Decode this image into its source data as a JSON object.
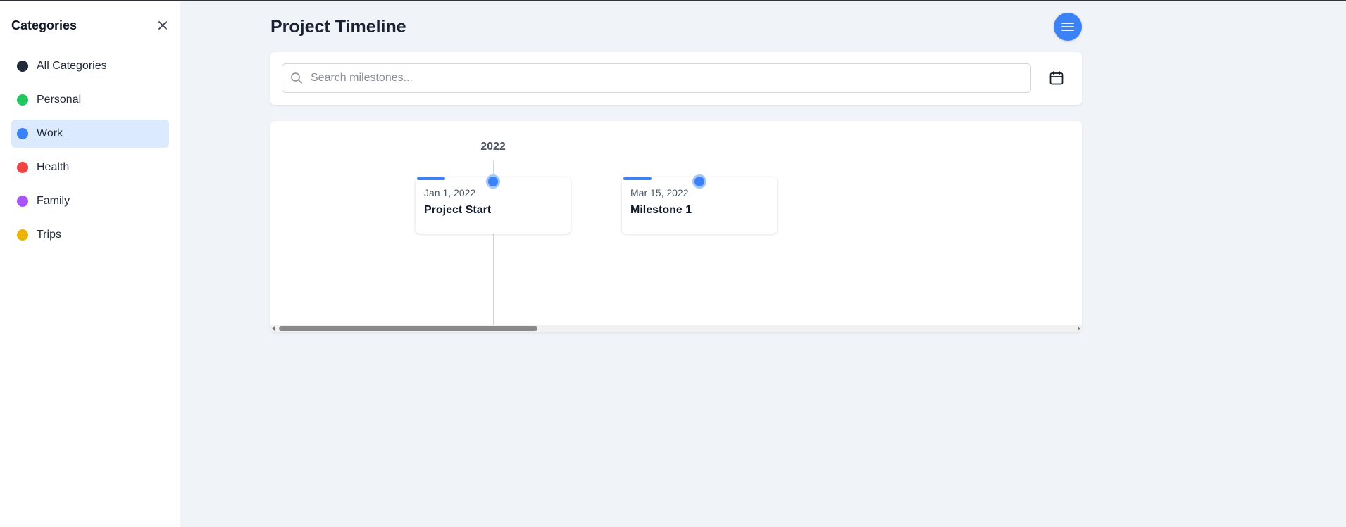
{
  "sidebar": {
    "title": "Categories",
    "items": [
      {
        "label": "All Categories",
        "color": "#1f2937",
        "active": false
      },
      {
        "label": "Personal",
        "color": "#22c55e",
        "active": false
      },
      {
        "label": "Work",
        "color": "#3b82f6",
        "active": true
      },
      {
        "label": "Health",
        "color": "#ef4444",
        "active": false
      },
      {
        "label": "Family",
        "color": "#a855f7",
        "active": false
      },
      {
        "label": "Trips",
        "color": "#eab308",
        "active": false
      }
    ]
  },
  "header": {
    "title": "Project Timeline",
    "menu_icon": "hamburger-menu-icon"
  },
  "search": {
    "placeholder": "Search milestones...",
    "value": "",
    "calendar_icon": "calendar-icon"
  },
  "timeline": {
    "year": "2022",
    "milestones": [
      {
        "date": "Jan 1, 2022",
        "title": "Project Start",
        "color": "#3b82f6"
      },
      {
        "date": "Mar 15, 2022",
        "title": "Milestone 1",
        "color": "#3b82f6"
      }
    ]
  },
  "colors": {
    "accent": "#3b82f6",
    "active_bg": "#dbeafe",
    "page_bg": "#f0f3f8"
  }
}
